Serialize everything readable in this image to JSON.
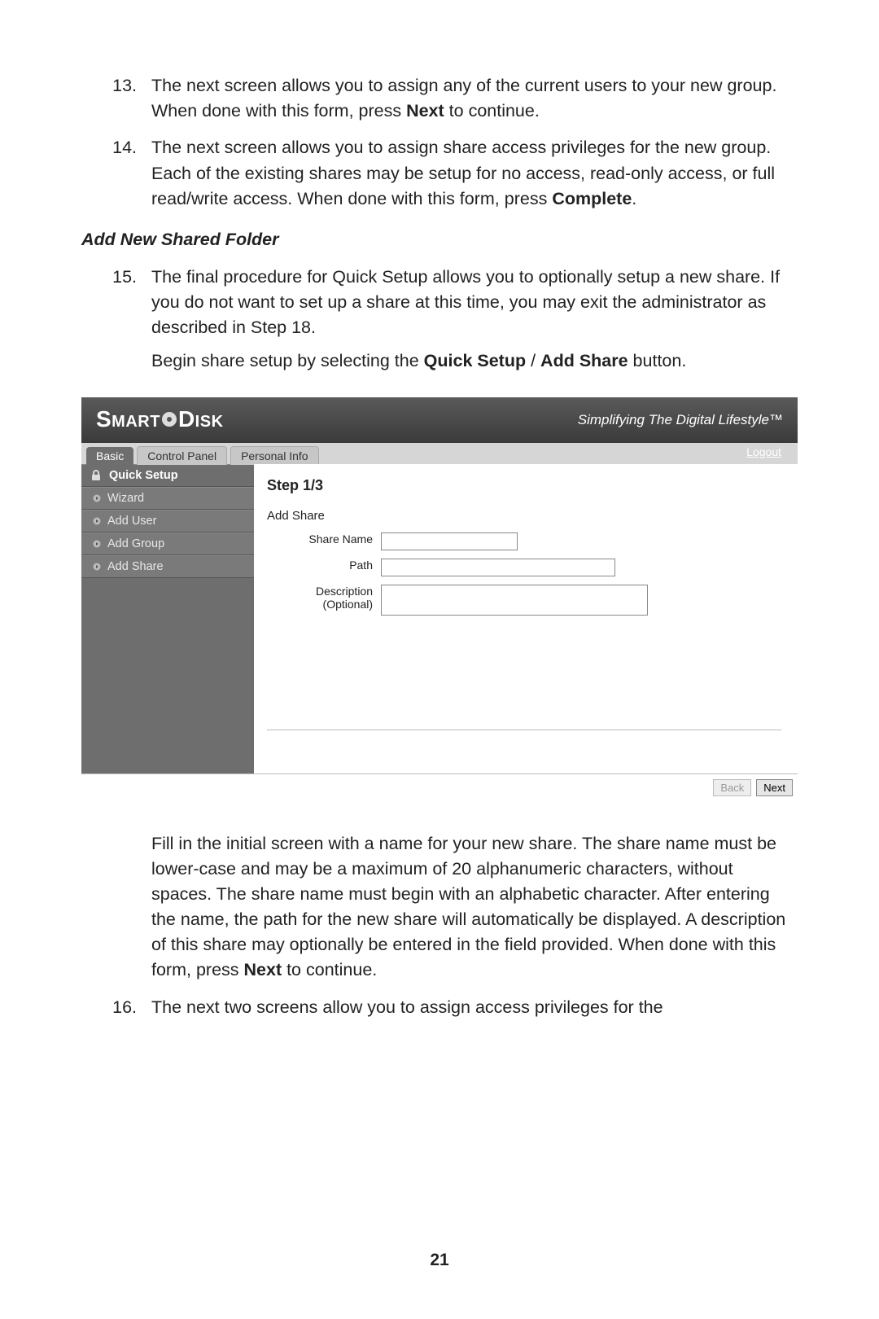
{
  "items": {
    "n13": {
      "num": "13.",
      "text_pre": "The next screen allows you to assign any of the current users to your new group. When done with this form, press ",
      "bold": "Next",
      "text_post": " to continue."
    },
    "n14": {
      "num": "14.",
      "text_pre": "The next screen allows you to assign share access privileges for the new group. Each of the existing shares may be setup for no access, read-only access, or full read/write access. When done with this form, press ",
      "bold": "Complete",
      "text_post": "."
    },
    "n15": {
      "num": "15.",
      "p1": "The final procedure for Quick Setup allows you to optionally setup a new share. If you do not want to set up a share at this time, you may exit the administrator as described in Step 18.",
      "p2_pre": "Begin share setup by selecting the ",
      "p2_b1": "Quick Setup",
      "p2_mid": " / ",
      "p2_b2": "Add Share",
      "p2_post": " button."
    },
    "after": {
      "pre": "Fill in the initial screen with a name for your new share. The share name must be lower-case and may be a maximum of 20 alphanumeric characters, without spaces. The share name must begin with an alphabetic character. After entering the name, the path for the new share will automatically be displayed. A description of this share may optionally be entered in the field provided. When done with this form, press ",
      "bold": "Next",
      "post": " to continue."
    },
    "n16": {
      "num": "16.",
      "text": "The next two screens allow you to assign access privileges for the"
    }
  },
  "subhead": "Add New Shared Folder",
  "page_number": "21",
  "shot": {
    "logo_a": "Smart",
    "logo_b": "Disk",
    "tagline": "Simplifying The Digital Lifestyle™",
    "tabs": {
      "basic": "Basic",
      "cp": "Control Panel",
      "pi": "Personal Info"
    },
    "logout": "Logout",
    "sidebar": {
      "quick_setup": "Quick Setup",
      "wizard": "Wizard",
      "add_user": "Add User",
      "add_group": "Add Group",
      "add_share": "Add Share"
    },
    "step": "Step 1/3",
    "section": "Add Share",
    "labels": {
      "share_name": "Share Name",
      "path": "Path",
      "desc1": "Description",
      "desc2": "(Optional)"
    },
    "values": {
      "share_name": "",
      "path": "",
      "description": ""
    },
    "buttons": {
      "back": "Back",
      "next": "Next"
    }
  }
}
